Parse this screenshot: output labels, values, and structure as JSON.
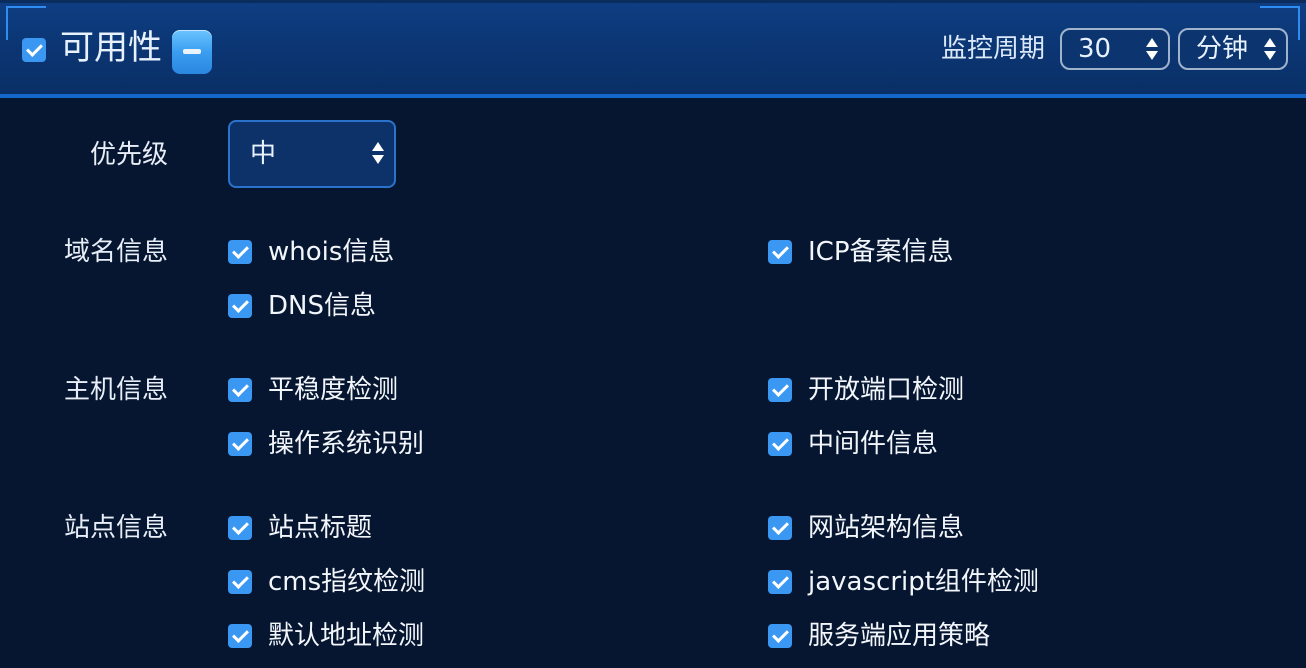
{
  "panel": {
    "title": "可用性",
    "title_checked": true,
    "collapse_icon": "minus-icon",
    "period_label": "监控周期",
    "period_value": "30",
    "period_unit": "分钟"
  },
  "priority": {
    "label": "优先级",
    "value": "中"
  },
  "groups": {
    "domain": {
      "label": "域名信息",
      "items": [
        {
          "label": "whois信息",
          "checked": true
        },
        {
          "label": "ICP备案信息",
          "checked": true
        },
        {
          "label": "DNS信息",
          "checked": true
        }
      ]
    },
    "host": {
      "label": "主机信息",
      "items": [
        {
          "label": "平稳度检测",
          "checked": true
        },
        {
          "label": "开放端口检测",
          "checked": true
        },
        {
          "label": "操作系统识别",
          "checked": true
        },
        {
          "label": "中间件信息",
          "checked": true
        }
      ]
    },
    "site": {
      "label": "站点信息",
      "items": [
        {
          "label": "站点标题",
          "checked": true
        },
        {
          "label": "网站架构信息",
          "checked": true
        },
        {
          "label": "cms指纹检测",
          "checked": true
        },
        {
          "label": "javascript组件检测",
          "checked": true
        },
        {
          "label": "默认地址检测",
          "checked": true
        },
        {
          "label": "服务端应用策略",
          "checked": true
        }
      ]
    }
  },
  "colors": {
    "background": "#061630",
    "header": "#0b3572",
    "checkbox": "#3a97f2",
    "accent": "#2f8cf0"
  }
}
